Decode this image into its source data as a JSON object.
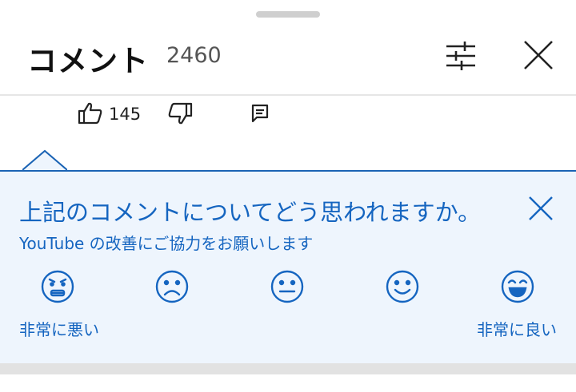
{
  "header": {
    "title": "コメント",
    "count": "2460",
    "filter_icon": "sliders-icon",
    "close_icon": "close-icon"
  },
  "comment_actions": {
    "like_icon": "thumb-up-icon",
    "like_count": "145",
    "dislike_icon": "thumb-down-icon",
    "reply_icon": "reply-icon"
  },
  "survey": {
    "question": "上記のコメントについてどう思われますか。",
    "subtitle": "YouTube の改善にご協力をお願いします",
    "close_icon": "close-icon",
    "scale": [
      {
        "icon": "very-bad-face-icon"
      },
      {
        "icon": "bad-face-icon"
      },
      {
        "icon": "neutral-face-icon"
      },
      {
        "icon": "good-face-icon"
      },
      {
        "icon": "very-good-face-icon"
      }
    ],
    "label_low": "非常に悪い",
    "label_high": "非常に良い"
  },
  "colors": {
    "accent": "#1565c0",
    "survey_bg": "#eef5fd"
  }
}
